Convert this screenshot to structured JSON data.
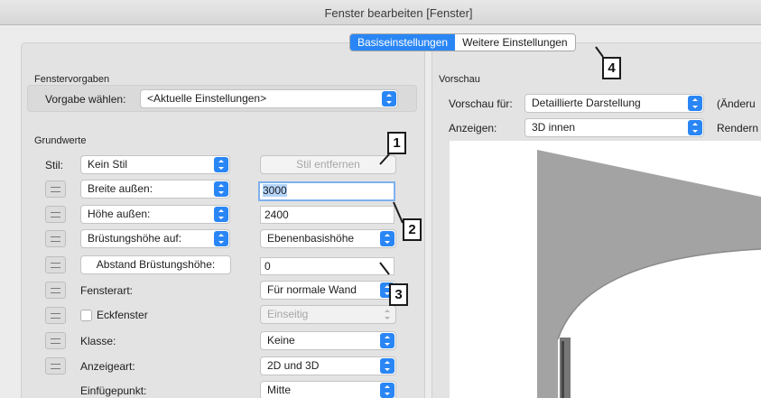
{
  "window": {
    "title": "Fenster bearbeiten [Fenster]"
  },
  "tabs": [
    {
      "label": "Basiseinstellungen",
      "active": true
    },
    {
      "label": "Weitere Einstellungen",
      "active": false
    }
  ],
  "fenstervorgaben": {
    "section_title": "Fenstervorgaben",
    "vorgabe_label": "Vorgabe wählen:",
    "vorgabe_value": "<Aktuelle Einstellungen>"
  },
  "grundwerte": {
    "section_title": "Grundwerte",
    "stil_label": "Stil:",
    "stil_value": "Kein Stil",
    "stil_entfernen": "Stil entfernen",
    "breite_label": "Breite außen:",
    "breite_value": "3000",
    "hoehe_label": "Höhe außen:",
    "hoehe_value": "2400",
    "bruestung_label": "Brüstungshöhe auf:",
    "bruestung_value": "Ebenenbasishöhe",
    "abstand_button": "Abstand Brüstungshöhe:",
    "abstand_value": "0",
    "fensterart_label": "Fensterart:",
    "fensterart_value": "Für normale Wand",
    "eckfenster_label": "Eckfenster",
    "eckfenster_value": "Einseitig",
    "klasse_label": "Klasse:",
    "klasse_value": "Keine",
    "anzeigeart_label": "Anzeigeart:",
    "anzeigeart_value": "2D und 3D",
    "einfuegepunkt_label": "Einfügepunkt:",
    "einfuegepunkt_value": "Mitte"
  },
  "vorschau": {
    "section_title": "Vorschau",
    "vorschau_fuer_label": "Vorschau für:",
    "vorschau_fuer_value": "Detaillierte Darstellung",
    "aenderung_label": "(Änderu",
    "anzeigen_label": "Anzeigen:",
    "anzeigen_value": "3D innen",
    "rendern_label": "Rendern"
  },
  "callouts": [
    "1",
    "2",
    "3",
    "4"
  ],
  "colors": {
    "accent": "#2a86f5",
    "callout_border": "#1b1b1b",
    "wall_gray": "#a3a3a3"
  }
}
